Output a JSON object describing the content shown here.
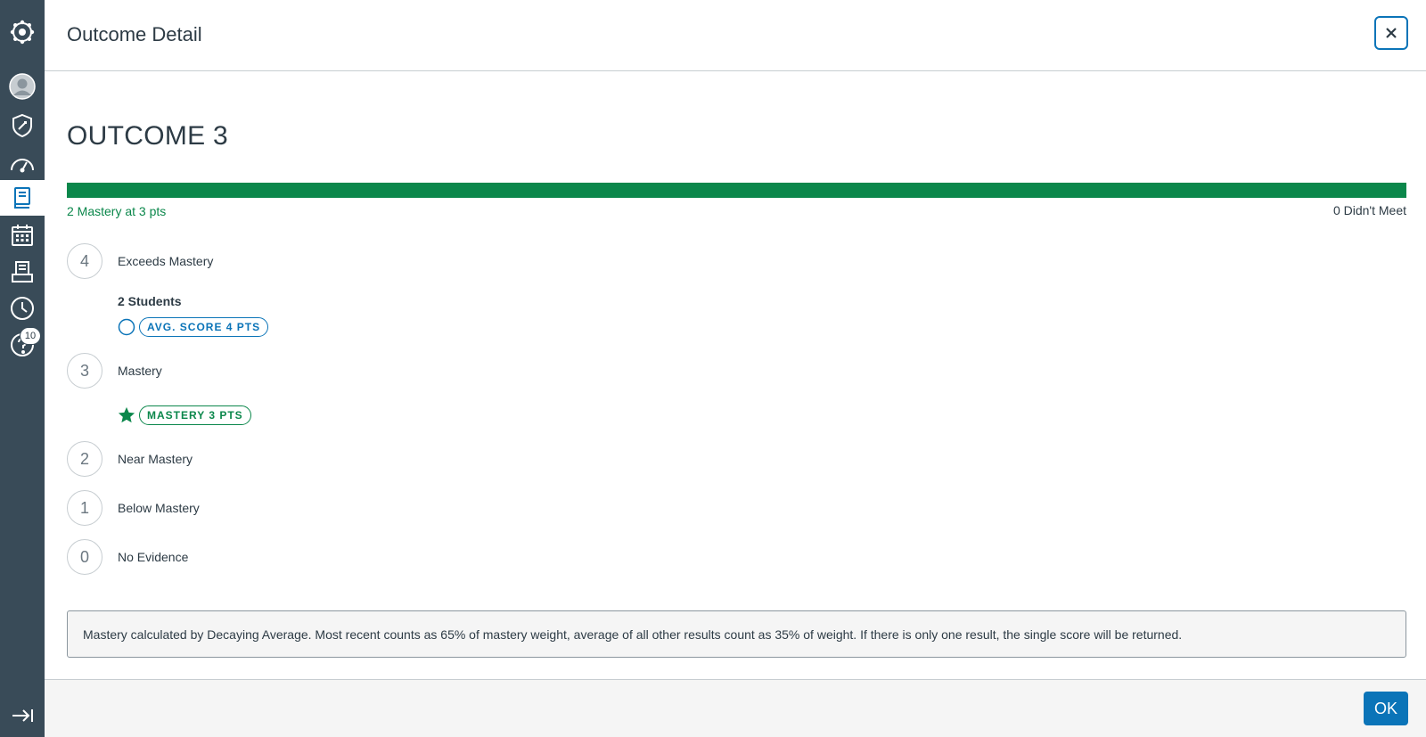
{
  "sidebar": {
    "items": [
      {
        "icon": "canvas-logo-icon",
        "active": false
      },
      {
        "icon": "account-avatar-icon",
        "active": false
      },
      {
        "icon": "admin-shield-icon",
        "active": false
      },
      {
        "icon": "dashboard-gauge-icon",
        "active": false
      },
      {
        "icon": "courses-book-icon",
        "active": true
      },
      {
        "icon": "calendar-icon",
        "active": false
      },
      {
        "icon": "inbox-icon",
        "active": false
      },
      {
        "icon": "history-clock-icon",
        "active": false
      },
      {
        "icon": "help-icon",
        "active": false,
        "badge": "10"
      }
    ],
    "collapse_icon": "collapse-arrow-icon"
  },
  "header": {
    "title": "Outcome Detail",
    "close_icon": "close-icon"
  },
  "main": {
    "outcome_title": "OUTCOME 3",
    "progress": {
      "mastery_fraction": 1.0,
      "color": "#0b874b",
      "left_label": "2 Mastery at 3 pts",
      "right_label": "0 Didn't Meet"
    },
    "ratings": [
      {
        "points": "4",
        "label": "Exceeds Mastery"
      },
      {
        "points": "3",
        "label": "Mastery"
      },
      {
        "points": "2",
        "label": "Near Mastery"
      },
      {
        "points": "1",
        "label": "Below Mastery"
      },
      {
        "points": "0",
        "label": "No Evidence"
      }
    ],
    "students_count": "2 Students",
    "avg_score_pill": "AVG. SCORE 4 PTS",
    "mastery_pill": "MASTERY 3 PTS",
    "note": "Mastery calculated by Decaying Average. Most recent counts as 65% of mastery weight, average of all other results count as 35% of weight. If there is only one result, the single score will be returned."
  },
  "footer": {
    "ok_label": "OK"
  },
  "colors": {
    "sidebar_bg": "#394b58",
    "accent_blue": "#0b74b8",
    "mastery_green": "#0b874b",
    "text": "#2d3b45"
  }
}
